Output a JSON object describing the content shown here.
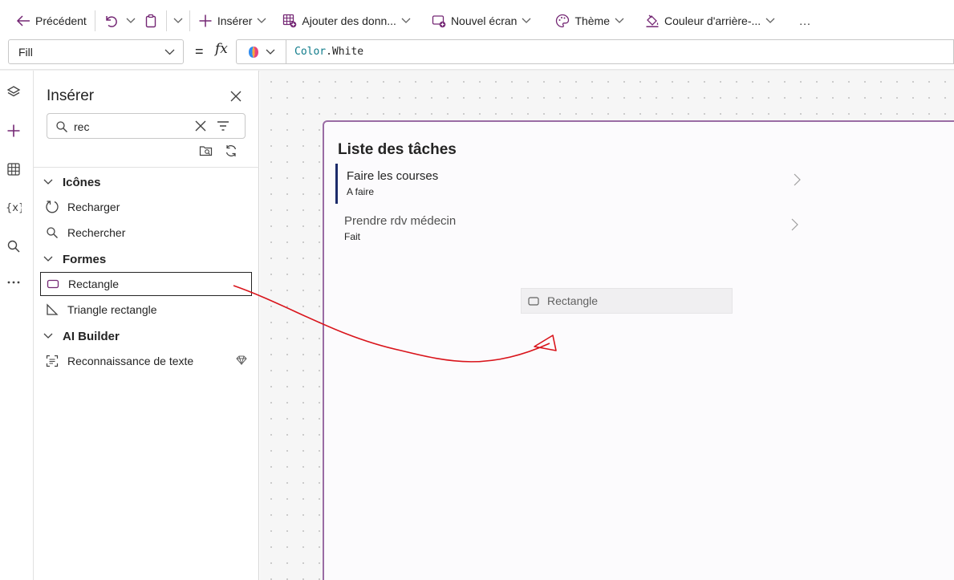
{
  "commandbar": {
    "back_label": "Précédent",
    "insert_label": "Insérer",
    "add_data_label": "Ajouter des donn...",
    "new_screen_label": "Nouvel écran",
    "theme_label": "Thème",
    "background_label": "Couleur d'arrière-...",
    "more_label": "..."
  },
  "formulabar": {
    "property": "Fill",
    "equals": "=",
    "fx": "fx",
    "formula_object": "Color",
    "formula_property": ".White"
  },
  "insert_panel": {
    "title": "Insérer",
    "search_value": "rec",
    "sections": [
      {
        "label": "Icônes",
        "items": [
          {
            "label": "Recharger"
          },
          {
            "label": "Rechercher"
          }
        ]
      },
      {
        "label": "Formes",
        "items": [
          {
            "label": "Rectangle"
          },
          {
            "label": "Triangle rectangle"
          }
        ]
      },
      {
        "label": "AI Builder",
        "items": [
          {
            "label": "Reconnaissance de texte"
          }
        ]
      }
    ]
  },
  "screen": {
    "title": "Liste des tâches",
    "rows": [
      {
        "title": "Faire les courses",
        "subtitle": "A faire"
      },
      {
        "title": "Prendre rdv médecin",
        "subtitle": "Fait"
      }
    ],
    "drag_preview_label": "Rectangle"
  },
  "colors": {
    "accent": "#742774",
    "screen_border": "#9a6ca4",
    "selection_bar": "#1c2b6a",
    "annotation_arrow": "#d9141b"
  }
}
